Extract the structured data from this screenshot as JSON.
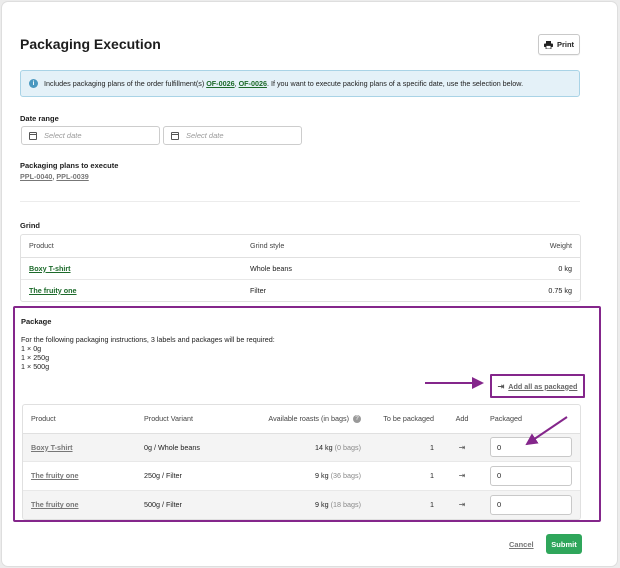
{
  "header": {
    "title": "Packaging Execution",
    "print_label": "Print",
    "print_icon": "printer-icon"
  },
  "info": {
    "text_before": "Includes packaging plans of the order fulfillment(s) ",
    "orders": [
      "OF-0026",
      "OF-0026"
    ],
    "separator": ", ",
    "text_after": ". If you want to execute packing plans of a specific date, use the selection below.",
    "icon": "info-icon",
    "colors": {
      "bg": "#e4f1f8",
      "border": "#a9d3e6"
    }
  },
  "date_range": {
    "label": "Date range",
    "start_placeholder": "Select date",
    "end_placeholder": "Select date"
  },
  "plans": {
    "label": "Packaging plans to execute",
    "items": [
      "PPL-0040",
      "PPL-0039"
    ],
    "separator": ", "
  },
  "grind": {
    "label": "Grind",
    "columns": [
      "Product",
      "Grind style",
      "Weight"
    ],
    "rows": [
      {
        "product": "Boxy T-shirt",
        "style": "Whole beans",
        "weight": "0 kg"
      },
      {
        "product": "The fruity one",
        "style": "Filter",
        "weight": "0.75 kg"
      }
    ]
  },
  "package": {
    "label": "Package",
    "intro": "For the following packaging instructions, 3 labels and packages will be required:",
    "lines": [
      "1 × 0g",
      "1 × 250g",
      "1 × 500g"
    ],
    "add_all_label": "Add all as packaged",
    "columns": {
      "product": "Product",
      "variant": "Product Variant",
      "available": "Available roasts (in bags)",
      "to_package": "To be packaged",
      "add": "Add",
      "packaged": "Packaged"
    },
    "rows": [
      {
        "product": "Boxy T-shirt",
        "variant": "0g / Whole beans",
        "kg": "14 kg",
        "bags": "(0 bags)",
        "to_package": "1",
        "packaged": "0"
      },
      {
        "product": "The fruity one",
        "variant": "250g / Filter",
        "kg": "9 kg",
        "bags": "(36 bags)",
        "to_package": "1",
        "packaged": "0"
      },
      {
        "product": "The fruity one",
        "variant": "500g / Filter",
        "kg": "9 kg",
        "bags": "(18 bags)",
        "to_package": "1",
        "packaged": "0"
      }
    ]
  },
  "footer": {
    "cancel_label": "Cancel",
    "submit_label": "Submit"
  },
  "colors": {
    "accent_green": "#2fa65b",
    "link_green": "#1c6a2a",
    "highlight_purple": "#84268b"
  }
}
